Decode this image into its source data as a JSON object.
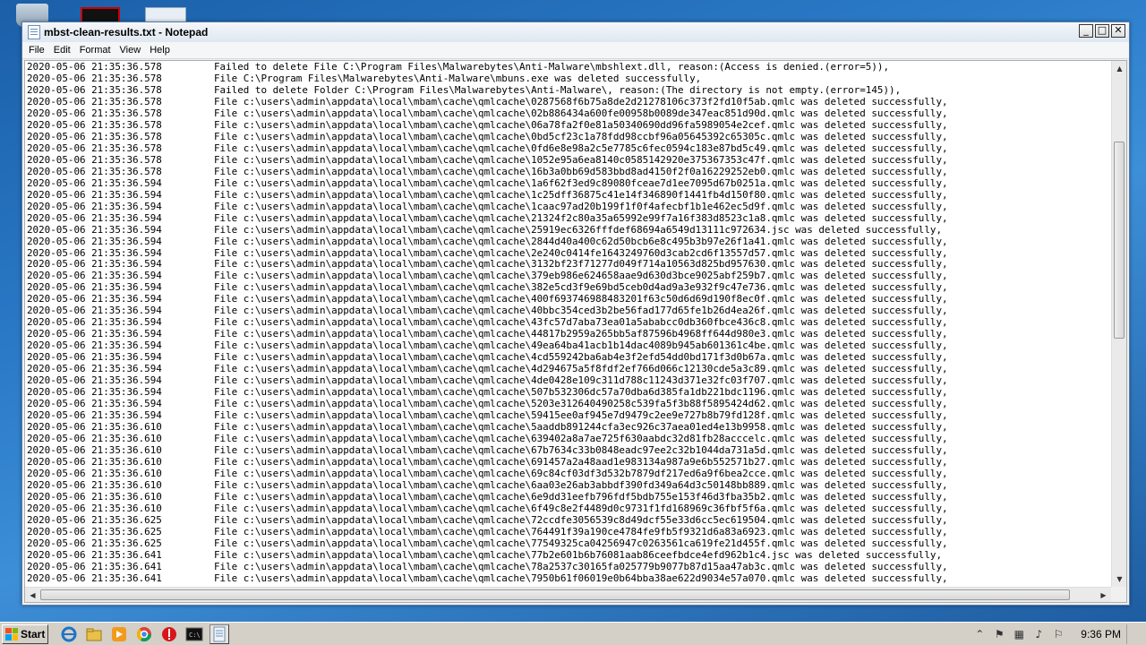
{
  "window": {
    "title": "mbst-clean-results.txt - Notepad",
    "controls": {
      "minimize": "_",
      "maximize": "□",
      "close": "✕"
    }
  },
  "menu": [
    "File",
    "Edit",
    "Format",
    "View",
    "Help"
  ],
  "lines": [
    [
      "2020-05-06 21:35:36.578",
      "Failed to delete File C:\\Program Files\\Malwarebytes\\Anti-Malware\\mbshlext.dll, reason:(Access is denied.(error=5)),"
    ],
    [
      "2020-05-06 21:35:36.578",
      "File C:\\Program Files\\Malwarebytes\\Anti-Malware\\mbuns.exe was deleted successfully,"
    ],
    [
      "2020-05-06 21:35:36.578",
      "Failed to delete Folder C:\\Program Files\\Malwarebytes\\Anti-Malware\\, reason:(The directory is not empty.(error=145)),"
    ],
    [
      "2020-05-06 21:35:36.578",
      "File c:\\users\\admin\\appdata\\local\\mbam\\cache\\qmlcache\\0287568f6b75a8de2d21278106c373f2fd10f5ab.qmlc was deleted successfully,"
    ],
    [
      "2020-05-06 21:35:36.578",
      "File c:\\users\\admin\\appdata\\local\\mbam\\cache\\qmlcache\\02b886434a600fe00958b0089de347eac851d90d.qmlc was deleted successfully,"
    ],
    [
      "2020-05-06 21:35:36.578",
      "File c:\\users\\admin\\appdata\\local\\mbam\\cache\\qmlcache\\06a78fa2f0e81a50340690dd96fa5989054e2cef.qmlc was deleted successfully,"
    ],
    [
      "2020-05-06 21:35:36.578",
      "File c:\\users\\admin\\appdata\\local\\mbam\\cache\\qmlcache\\0bd5cf23c1a78fdd98ccbf96a05645392c65305c.qmlc was deleted successfully,"
    ],
    [
      "2020-05-06 21:35:36.578",
      "File c:\\users\\admin\\appdata\\local\\mbam\\cache\\qmlcache\\0fd6e8e98a2c5e7785c6fec0594c183e87bd5c49.qmlc was deleted successfully,"
    ],
    [
      "2020-05-06 21:35:36.578",
      "File c:\\users\\admin\\appdata\\local\\mbam\\cache\\qmlcache\\1052e95a6ea8140c0585142920e375367353c47f.qmlc was deleted successfully,"
    ],
    [
      "2020-05-06 21:35:36.578",
      "File c:\\users\\admin\\appdata\\local\\mbam\\cache\\qmlcache\\16b3a0bb69d583bbd8ad4150f2f0a16229252eb0.qmlc was deleted successfully,"
    ],
    [
      "2020-05-06 21:35:36.594",
      "File c:\\users\\admin\\appdata\\local\\mbam\\cache\\qmlcache\\1a6f62f3ed9c89080fceae7d1ee7095d67b0251a.qmlc was deleted successfully,"
    ],
    [
      "2020-05-06 21:35:36.594",
      "File c:\\users\\admin\\appdata\\local\\mbam\\cache\\qmlcache\\1c25dff36875c41e14f346890f1441fb4d150f80.qmlc was deleted successfully,"
    ],
    [
      "2020-05-06 21:35:36.594",
      "File c:\\users\\admin\\appdata\\local\\mbam\\cache\\qmlcache\\1caac97ad20b199f1f0f4afecbf1b1e462ec5d9f.qmlc was deleted successfully,"
    ],
    [
      "2020-05-06 21:35:36.594",
      "File c:\\users\\admin\\appdata\\local\\mbam\\cache\\qmlcache\\21324f2c80a35a65992e99f7a16f383d8523c1a8.qmlc was deleted successfully,"
    ],
    [
      "2020-05-06 21:35:36.594",
      "File c:\\users\\admin\\appdata\\local\\mbam\\cache\\qmlcache\\25919ec6326fffdef68694a6549d13111c972634.jsc was deleted successfully,"
    ],
    [
      "2020-05-06 21:35:36.594",
      "File c:\\users\\admin\\appdata\\local\\mbam\\cache\\qmlcache\\2844d40a400c62d50bcb6e8c495b3b97e26f1a41.qmlc was deleted successfully,"
    ],
    [
      "2020-05-06 21:35:36.594",
      "File c:\\users\\admin\\appdata\\local\\mbam\\cache\\qmlcache\\2e240c0414fe1643249760d3cab2cd6f13557d57.qmlc was deleted successfully,"
    ],
    [
      "2020-05-06 21:35:36.594",
      "File c:\\users\\admin\\appdata\\local\\mbam\\cache\\qmlcache\\3132bf23f71277d049f714a10563d825bd957630.qmlc was deleted successfully,"
    ],
    [
      "2020-05-06 21:35:36.594",
      "File c:\\users\\admin\\appdata\\local\\mbam\\cache\\qmlcache\\379eb986e624658aae9d630d3bce9025abf259b7.qmlc was deleted successfully,"
    ],
    [
      "2020-05-06 21:35:36.594",
      "File c:\\users\\admin\\appdata\\local\\mbam\\cache\\qmlcache\\382e5cd3f9e69bd5ceb0d4ad9a3e932f9c47e736.qmlc was deleted successfully,"
    ],
    [
      "2020-05-06 21:35:36.594",
      "File c:\\users\\admin\\appdata\\local\\mbam\\cache\\qmlcache\\400f693746988483201f63c50d6d69d190f8ec0f.qmlc was deleted successfully,"
    ],
    [
      "2020-05-06 21:35:36.594",
      "File c:\\users\\admin\\appdata\\local\\mbam\\cache\\qmlcache\\40bbc354ced3b2be56fad177d65fe1b26d4ea26f.qmlc was deleted successfully,"
    ],
    [
      "2020-05-06 21:35:36.594",
      "File c:\\users\\admin\\appdata\\local\\mbam\\cache\\qmlcache\\43fc57d7aba73ea01a5ababcc0db360fbce436c8.qmlc was deleted successfully,"
    ],
    [
      "2020-05-06 21:35:36.594",
      "File c:\\users\\admin\\appdata\\local\\mbam\\cache\\qmlcache\\44817b2959a265bb5af87596b4968ff644d980e3.qmlc was deleted successfully,"
    ],
    [
      "2020-05-06 21:35:36.594",
      "File c:\\users\\admin\\appdata\\local\\mbam\\cache\\qmlcache\\49ea64ba41acb1b14dac4089b945ab601361c4be.qmlc was deleted successfully,"
    ],
    [
      "2020-05-06 21:35:36.594",
      "File c:\\users\\admin\\appdata\\local\\mbam\\cache\\qmlcache\\4cd559242ba6ab4e3f2efd54dd0bd171f3d0b67a.qmlc was deleted successfully,"
    ],
    [
      "2020-05-06 21:35:36.594",
      "File c:\\users\\admin\\appdata\\local\\mbam\\cache\\qmlcache\\4d294675a5f8fdf2ef766d066c12130cde5a3c89.qmlc was deleted successfully,"
    ],
    [
      "2020-05-06 21:35:36.594",
      "File c:\\users\\admin\\appdata\\local\\mbam\\cache\\qmlcache\\4de0428e109c311d788c11243d371e32fc03f707.qmlc was deleted successfully,"
    ],
    [
      "2020-05-06 21:35:36.594",
      "File c:\\users\\admin\\appdata\\local\\mbam\\cache\\qmlcache\\507b532306dc57a70dba6d385fa1db221bdc1196.qmlc was deleted successfully,"
    ],
    [
      "2020-05-06 21:35:36.594",
      "File c:\\users\\admin\\appdata\\local\\mbam\\cache\\qmlcache\\5203e312640490258c539fa5f3b88f5895424d62.qmlc was deleted successfully,"
    ],
    [
      "2020-05-06 21:35:36.594",
      "File c:\\users\\admin\\appdata\\local\\mbam\\cache\\qmlcache\\59415ee0af945e7d9479c2ee9e727b8b79fd128f.qmlc was deleted successfully,"
    ],
    [
      "2020-05-06 21:35:36.610",
      "File c:\\users\\admin\\appdata\\local\\mbam\\cache\\qmlcache\\5aaddb891244cfa3ec926c37aea01ed4e13b9958.qmlc was deleted successfully,"
    ],
    [
      "2020-05-06 21:35:36.610",
      "File c:\\users\\admin\\appdata\\local\\mbam\\cache\\qmlcache\\639402a8a7ae725f630aabdc32d81fb28acccelc.qmlc was deleted successfully,"
    ],
    [
      "2020-05-06 21:35:36.610",
      "File c:\\users\\admin\\appdata\\local\\mbam\\cache\\qmlcache\\67b7634c33b0848eadc97ee2c32b1044da731a5d.qmlc was deleted successfully,"
    ],
    [
      "2020-05-06 21:35:36.610",
      "File c:\\users\\admin\\appdata\\local\\mbam\\cache\\qmlcache\\691457a2a48aad1e983134a987a9e6b552571b27.qmlc was deleted successfully,"
    ],
    [
      "2020-05-06 21:35:36.610",
      "File c:\\users\\admin\\appdata\\local\\mbam\\cache\\qmlcache\\69c84cf03df3d532b7879df217ed6a9f6bea2cce.qmlc was deleted successfully,"
    ],
    [
      "2020-05-06 21:35:36.610",
      "File c:\\users\\admin\\appdata\\local\\mbam\\cache\\qmlcache\\6aa03e26ab3abbdf390fd349a64d3c50148bb889.qmlc was deleted successfully,"
    ],
    [
      "2020-05-06 21:35:36.610",
      "File c:\\users\\admin\\appdata\\local\\mbam\\cache\\qmlcache\\6e9dd31eefb796fdf5bdb755e153f46d3fba35b2.qmlc was deleted successfully,"
    ],
    [
      "2020-05-06 21:35:36.610",
      "File c:\\users\\admin\\appdata\\local\\mbam\\cache\\qmlcache\\6f49c8e2f4489d0c9731f1fd168969c36fbf5f6a.qmlc was deleted successfully,"
    ],
    [
      "2020-05-06 21:35:36.625",
      "File c:\\users\\admin\\appdata\\local\\mbam\\cache\\qmlcache\\72ccdfe3056539c8d49dcf55e33d6cc5ec619504.qmlc was deleted successfully,"
    ],
    [
      "2020-05-06 21:35:36.625",
      "File c:\\users\\admin\\appdata\\local\\mbam\\cache\\qmlcache\\764491f39a190ce4784fe9fb5f9321d6a83a6923.qmlc was deleted successfully,"
    ],
    [
      "2020-05-06 21:35:36.625",
      "File c:\\users\\admin\\appdata\\local\\mbam\\cache\\qmlcache\\77549325ca04256947c0263561ca619fe21d455f.qmlc was deleted successfully,"
    ],
    [
      "2020-05-06 21:35:36.641",
      "File c:\\users\\admin\\appdata\\local\\mbam\\cache\\qmlcache\\77b2e601b6b76081aab86ceefbdce4efd962b1c4.jsc was deleted successfully,"
    ],
    [
      "2020-05-06 21:35:36.641",
      "File c:\\users\\admin\\appdata\\local\\mbam\\cache\\qmlcache\\78a2537c30165fa025779b9077b87d15aa47ab3c.qmlc was deleted successfully,"
    ],
    [
      "2020-05-06 21:35:36.641",
      "File c:\\users\\admin\\appdata\\local\\mbam\\cache\\qmlcache\\7950b61f06019e0b64bba38ae622d9034e57a070.qmlc was deleted successfully,"
    ]
  ],
  "taskbar": {
    "start_label": "Start",
    "clock": "9:36 PM"
  }
}
